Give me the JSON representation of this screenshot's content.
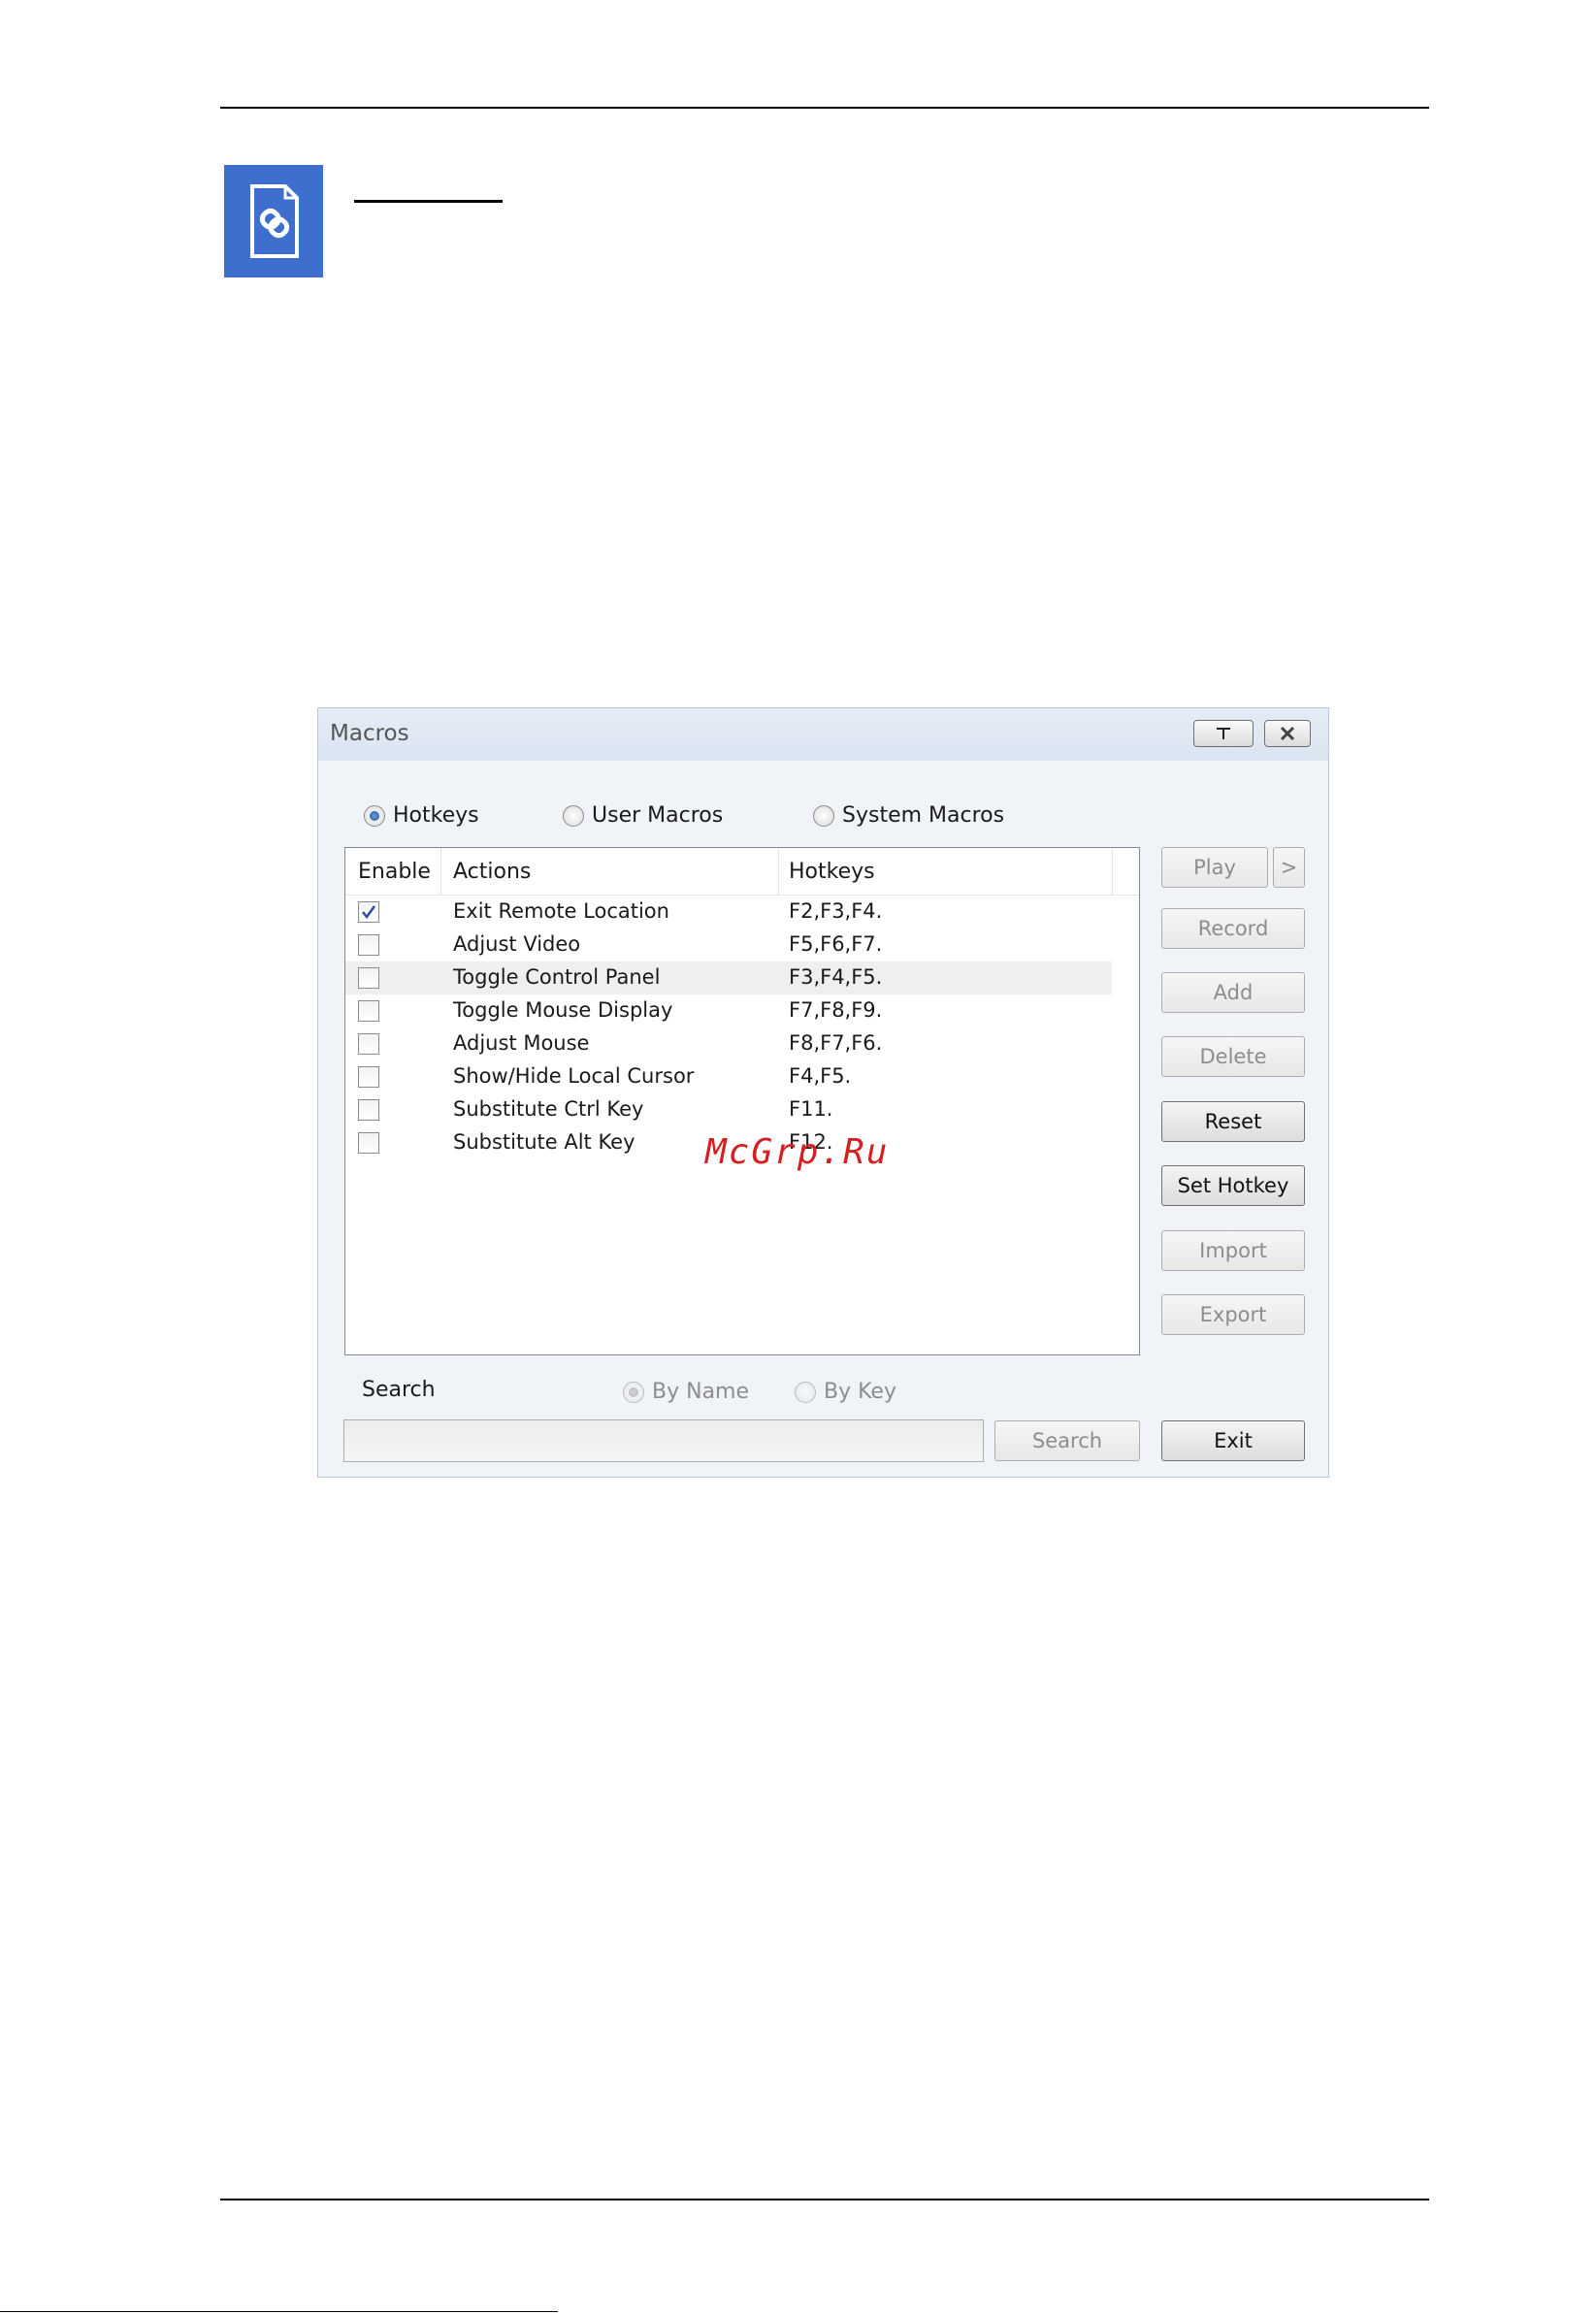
{
  "watermark": "McGrp.Ru",
  "dialog": {
    "title": "Macros",
    "modes": [
      {
        "label": "Hotkeys",
        "selected": true
      },
      {
        "label": "User Macros",
        "selected": false
      },
      {
        "label": "System Macros",
        "selected": false
      }
    ],
    "columns": [
      "Enable",
      "Actions",
      "Hotkeys"
    ],
    "rows": [
      {
        "enabled": true,
        "action": "Exit Remote Location",
        "hotkeys": "F2,F3,F4."
      },
      {
        "enabled": false,
        "action": "Adjust Video",
        "hotkeys": "F5,F6,F7."
      },
      {
        "enabled": false,
        "action": "Toggle Control Panel",
        "hotkeys": "F3,F4,F5."
      },
      {
        "enabled": false,
        "action": "Toggle Mouse Display",
        "hotkeys": "F7,F8,F9."
      },
      {
        "enabled": false,
        "action": "Adjust Mouse",
        "hotkeys": "F8,F7,F6."
      },
      {
        "enabled": false,
        "action": "Show/Hide Local Cursor",
        "hotkeys": "F4,F5."
      },
      {
        "enabled": false,
        "action": "Substitute Ctrl Key",
        "hotkeys": "F11."
      },
      {
        "enabled": false,
        "action": "Substitute Alt Key",
        "hotkeys": "F12."
      }
    ],
    "buttons": {
      "play": "Play",
      "play_more": ">",
      "record": "Record",
      "add": "Add",
      "delete": "Delete",
      "reset": "Reset",
      "set_hotkey": "Set Hotkey",
      "import": "Import",
      "export": "Export",
      "search": "Search",
      "exit": "Exit"
    },
    "search": {
      "label": "Search",
      "by_name": "By Name",
      "by_key": "By Key",
      "value": ""
    }
  }
}
